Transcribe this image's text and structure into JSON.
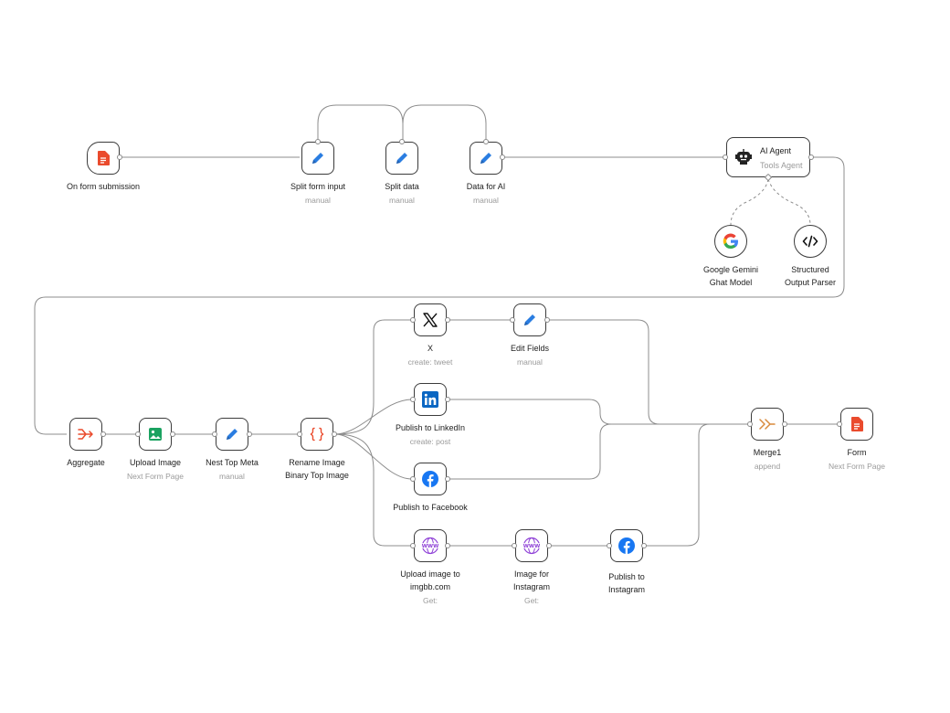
{
  "nodes": {
    "form_trigger": {
      "label": "On form submission",
      "icon": "form-icon"
    },
    "split_form_input": {
      "label": "Split form input",
      "sub": "manual",
      "icon": "pencil-icon"
    },
    "split_data": {
      "label": "Split data",
      "sub": "manual",
      "icon": "pencil-icon"
    },
    "data_for_ai": {
      "label": "Data for AI",
      "sub": "manual",
      "icon": "pencil-icon"
    },
    "ai_agent": {
      "label": "AI Agent",
      "sub": "Tools Agent",
      "icon": "robot-icon"
    },
    "gemini": {
      "label1": "Google Gemini",
      "label2": "Ghat Model",
      "icon": "google-icon"
    },
    "parser": {
      "label1": "Structured",
      "label2": "Output Parser",
      "icon": "code-icon"
    },
    "aggregate": {
      "label": "Aggregate",
      "icon": "aggregate-icon"
    },
    "upload_image": {
      "label": "Upload Image",
      "sub": "Next Form Page",
      "icon": "image-icon"
    },
    "nest_top_meta": {
      "label": "Nest Top Meta",
      "sub": "manual",
      "icon": "pencil-icon"
    },
    "rename_image": {
      "label1": "Rename Image",
      "label2": "Binary Top Image",
      "icon": "braces-icon"
    },
    "x": {
      "label": "X",
      "sub": "create: tweet",
      "icon": "x-icon"
    },
    "edit_fields": {
      "label": "Edit Fields",
      "sub": "manual",
      "icon": "pencil-icon"
    },
    "linkedin": {
      "label": "Publish to LinkedIn",
      "sub": "create: post",
      "icon": "linkedin-icon"
    },
    "facebook": {
      "label": "Publish to Facebook",
      "icon": "facebook-icon"
    },
    "upload_imgbb": {
      "label1": "Upload image to",
      "label2": "imgbb.com",
      "sub": "Get:",
      "icon": "www-icon"
    },
    "image_instagram": {
      "label1": "Image for",
      "label2": "Instagram",
      "sub": "Get:",
      "icon": "www-icon"
    },
    "publish_instagram": {
      "label1": "Publish to",
      "label2": "Instagram",
      "icon": "facebook-icon"
    },
    "merge": {
      "label": "Merge1",
      "sub": "append",
      "icon": "merge-icon"
    },
    "form": {
      "label": "Form",
      "sub": "Next Form Page",
      "icon": "form-icon"
    }
  },
  "colors": {
    "edge": "#8c8c8c",
    "pencil": "#2a7de1",
    "form": "#ea4b2d",
    "aggregate": "#ea4b2d",
    "image": "#1aa260",
    "braces": "#ea4b2d",
    "www": "#8e3fd6",
    "facebook": "#1877f2",
    "linkedin": "#0a66c2",
    "merge": "#d98a3c"
  }
}
